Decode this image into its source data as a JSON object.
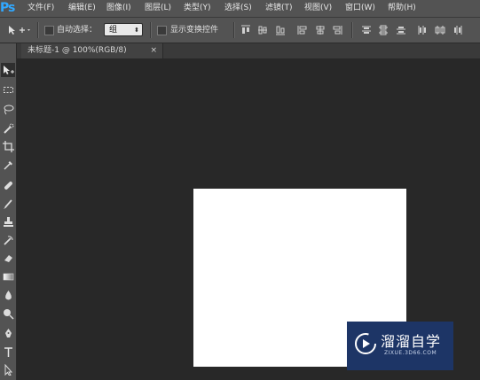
{
  "app": {
    "logo": "Ps"
  },
  "menu": [
    {
      "label": "文件(F)"
    },
    {
      "label": "编辑(E)"
    },
    {
      "label": "图像(I)"
    },
    {
      "label": "图层(L)"
    },
    {
      "label": "类型(Y)"
    },
    {
      "label": "选择(S)"
    },
    {
      "label": "滤镜(T)"
    },
    {
      "label": "视图(V)"
    },
    {
      "label": "窗口(W)"
    },
    {
      "label": "帮助(H)"
    }
  ],
  "options": {
    "move_tool_icon": "move-icon",
    "auto_select_label": "自动选择：",
    "auto_select_value": "组",
    "show_transform_label": "显示变换控件"
  },
  "document": {
    "tab_title": "未标题-1 @ 100%(RGB/8)",
    "close_glyph": "×",
    "canvas_color": "#ffffff"
  },
  "tools": [
    "move-tool",
    "marquee-tool",
    "lasso-tool",
    "quick-selection-tool",
    "crop-tool",
    "eyedropper-tool",
    "healing-brush-tool",
    "brush-tool",
    "clone-stamp-tool",
    "history-brush-tool",
    "eraser-tool",
    "gradient-tool",
    "blur-tool",
    "dodge-tool",
    "pen-tool",
    "type-tool",
    "path-selection-tool"
  ],
  "watermark": {
    "title": "溜溜自学",
    "subtitle": "ZIXUE.3D66.COM"
  },
  "colors": {
    "panel": "#535353",
    "workspace": "#282828",
    "accent": "#31a8ff",
    "watermark_bg": "#1d3566"
  }
}
